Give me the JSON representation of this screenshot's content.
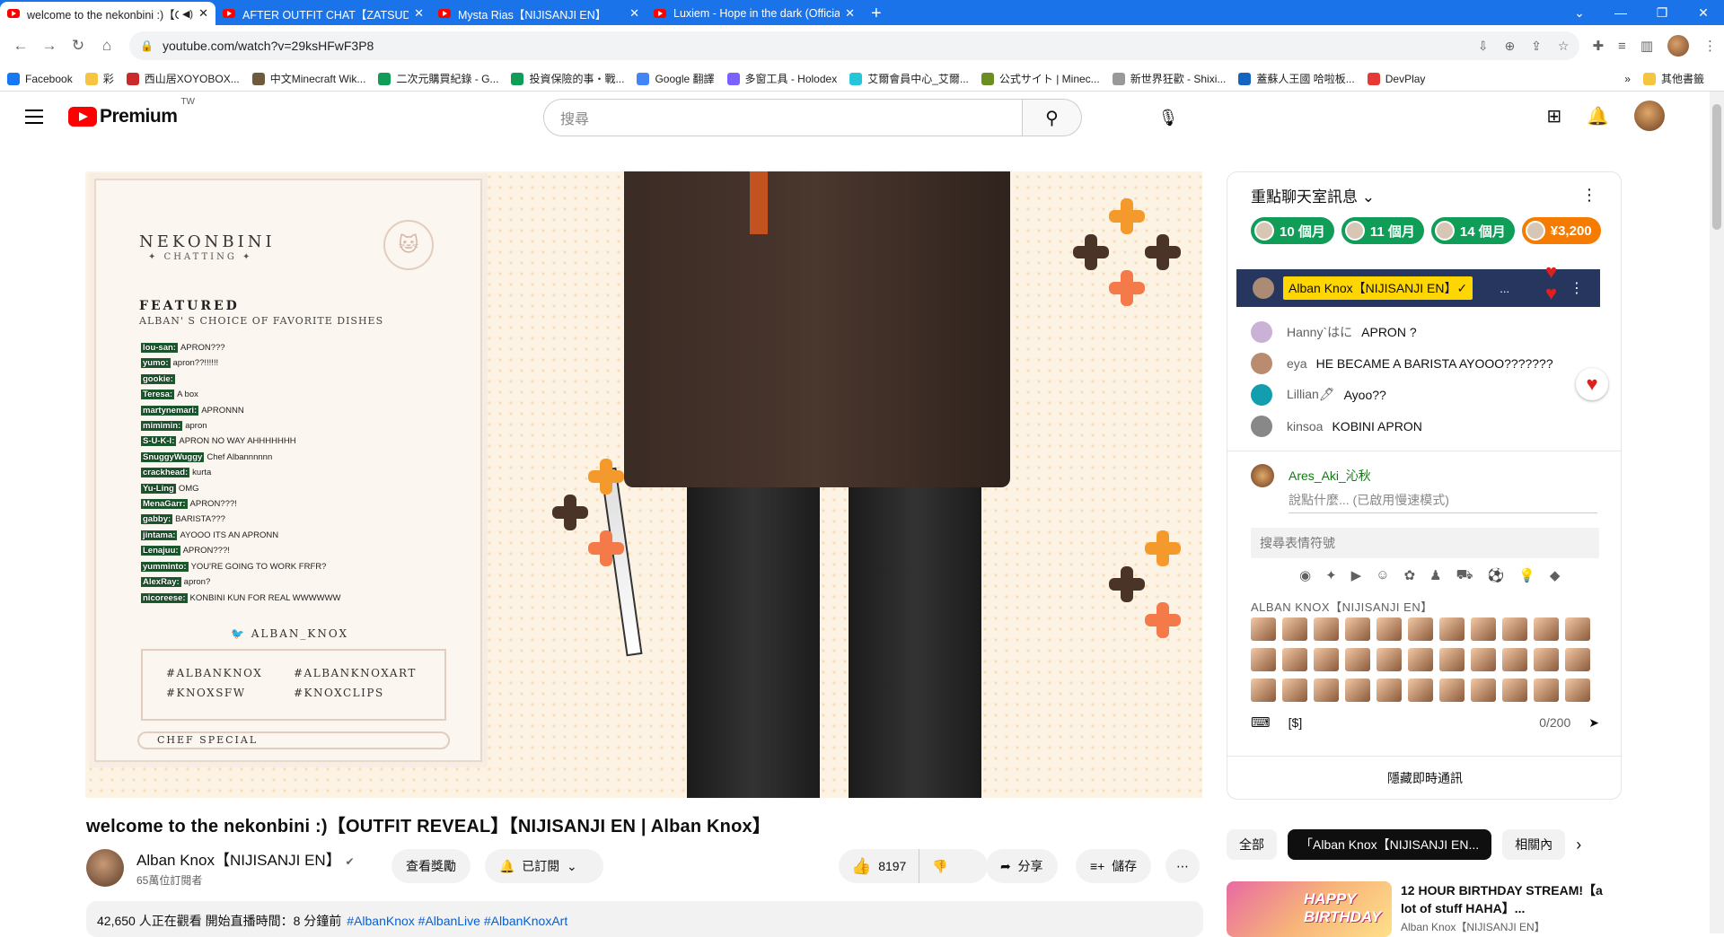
{
  "browser": {
    "tabs": [
      {
        "title": "welcome to the nekonbini :)【OUTFIT REVEAL】",
        "active": true
      },
      {
        "title": "AFTER OUTFIT CHAT【ZATSUDAN】",
        "active": false
      },
      {
        "title": "Mysta Rias【NIJISANJI EN】",
        "active": false
      },
      {
        "title": "Luxiem - Hope in the dark (Official)",
        "active": false
      }
    ],
    "url": "youtube.com/watch?v=29ksHFwF3P8",
    "bookmarks": [
      "Facebook",
      "彩",
      "西山居XOYOBOX...",
      "中文Minecraft Wik...",
      "二次元購買紀錄 - G...",
      "投資保險的事・戰...",
      "Google 翻譯",
      "多窗工具 - Holodex",
      "艾爾會員中心_艾爾...",
      "公式サイト | Minec...",
      "新世界狂歡 - Shixi...",
      "蓋蘇人王國 哈啦板...",
      "DevPlay"
    ],
    "other_bookmarks": "其他書籤"
  },
  "yt": {
    "logo": "Premium",
    "region": "TW",
    "search_placeholder": "搜尋"
  },
  "overlay": {
    "brand": "NEKONBINI",
    "brand_sub": "✦ CHATTING ✦",
    "featured": "FEATURED",
    "featured_sub": "ALBAN' S CHOICE OF FAVORITE DISHES",
    "chat": [
      {
        "n": "lou-san:",
        "m": "APRON???"
      },
      {
        "n": "yumo:",
        "m": "apron??!!!!!!"
      },
      {
        "n": "gookie:",
        "m": ""
      },
      {
        "n": "Teresa:",
        "m": "A box"
      },
      {
        "n": "martynemari:",
        "m": "APRONNN"
      },
      {
        "n": "mimimin:",
        "m": "apron"
      },
      {
        "n": "S-U-K-I:",
        "m": "APRON NO WAY AHHHHHHH"
      },
      {
        "n": "SnuggyWuggy",
        "m": "Chef Albannnnnn"
      },
      {
        "n": "crackhead:",
        "m": "kurta"
      },
      {
        "n": "Yu-Ling",
        "m": "OMG"
      },
      {
        "n": "MenaGarr:",
        "m": "APRON???!"
      },
      {
        "n": "gabby:",
        "m": "BARISTA???"
      },
      {
        "n": "jintama:",
        "m": "AYOOO ITS AN APRONN"
      },
      {
        "n": "Lenajuu:",
        "m": "APRON???!"
      },
      {
        "n": "yumminto:",
        "m": "YOU'RE GOING TO WORK FRFR?"
      },
      {
        "n": "AlexRay:",
        "m": "apron?"
      },
      {
        "n": "nicoreese:",
        "m": "KONBINI KUN FOR REAL WWWWWW"
      }
    ],
    "twitter": "ALBAN_KNOX",
    "tags": [
      "#ALBANKNOX",
      "#ALBANKNOXART",
      "#KNOXSFW",
      "#KNOXCLIPS"
    ],
    "chef": "CHEF SPECIAL"
  },
  "livechat": {
    "header": "重點聊天室訊息",
    "tickers": [
      {
        "label": "10 個月",
        "color": "#0f9d58"
      },
      {
        "label": "11 個月",
        "color": "#0f9d58"
      },
      {
        "label": "14 個月",
        "color": "#0f9d58"
      },
      {
        "label": "¥3,200",
        "color": "#f57c00"
      }
    ],
    "pinned_name": "Alban Knox【NIJISANJI EN】✓",
    "pinned_more": "...",
    "messages": [
      {
        "author": "Hanny`はに",
        "text": "APRON ?",
        "color": "#c9b2d6"
      },
      {
        "author": "eya",
        "text": "HE BECAME A BARISTA AYOOO???????",
        "color": "#b98c70"
      },
      {
        "author": "Lillian🖊",
        "text": "Ayoo??",
        "color": "#129eaf"
      },
      {
        "author": "kinsoa",
        "text": "KOBINI APRON",
        "color": "#888"
      }
    ],
    "me": "Ares_Aki_沁秋",
    "compose_placeholder": "說點什麼... (已啟用慢速模式)",
    "emoji_search": "搜尋表情符號",
    "emoji_section": "ALBAN KNOX【NIJISANJI EN】",
    "counter": "0/200",
    "hide": "隱藏即時通訊"
  },
  "video": {
    "title": "welcome to the nekonbini :)【OUTFIT REVEAL】【NIJISANJI EN | Alban Knox】",
    "channel": "Alban Knox【NIJISANJI EN】",
    "subs": "65萬位訂閱者",
    "perks": "查看獎勵",
    "subscribed": "已訂閱",
    "likes": "8197",
    "share": "分享",
    "save": "儲存",
    "desc_stats": "42,650 人正在觀看  開始直播時間：8 分鐘前",
    "desc_tags": "#AlbanKnox #AlbanLive #AlbanKnoxArt"
  },
  "related": {
    "chips": [
      "全部",
      "「Alban Knox【NIJISANJI EN...",
      "相關內"
    ],
    "item_title": "12 HOUR BIRTHDAY STREAM!【a lot of stuff HAHA】...",
    "item_channel": "Alban Knox【NIJISANJI EN】",
    "thumb_text": "HAPPY BIRTHDAY"
  }
}
